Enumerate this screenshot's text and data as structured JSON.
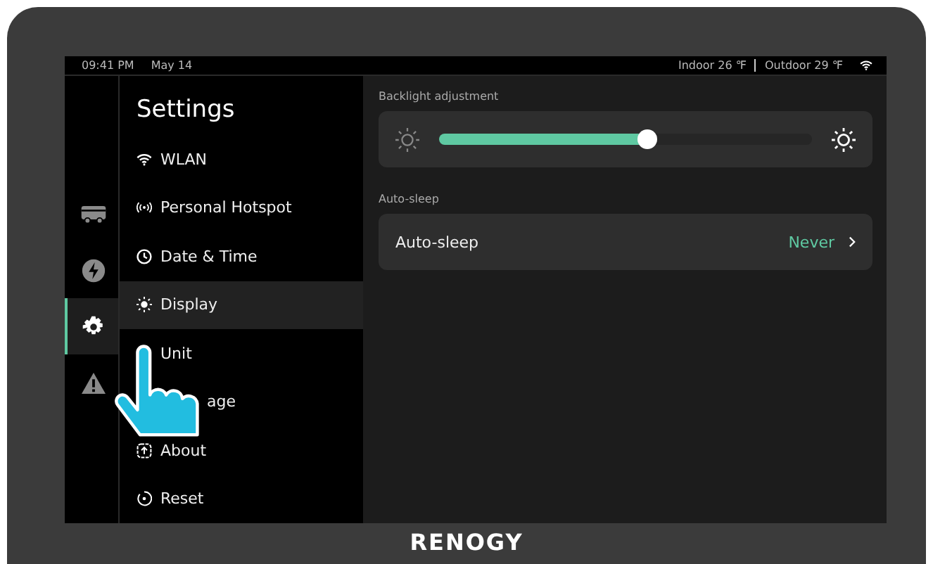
{
  "status_bar": {
    "time": "09:41 PM",
    "date": "May 14",
    "indoor": "Indoor 26 ℉",
    "outdoor": "Outdoor 29 ℉"
  },
  "rail": [
    {
      "kind": "rv",
      "selected": false
    },
    {
      "kind": "power",
      "selected": false
    },
    {
      "kind": "settings",
      "selected": true
    },
    {
      "kind": "alert",
      "selected": false
    }
  ],
  "menu": {
    "title": "Settings",
    "items": [
      {
        "kind": "wifi",
        "label": "WLAN",
        "selected": false
      },
      {
        "kind": "hotspot",
        "label": "Personal Hotspot",
        "selected": false
      },
      {
        "kind": "clock",
        "label": "Date & Time",
        "selected": false
      },
      {
        "kind": "sun",
        "label": "Display",
        "selected": true
      },
      {
        "kind": "none",
        "label": "Unit",
        "selected": false
      },
      {
        "kind": "covered",
        "label": "age",
        "selected": false
      },
      {
        "kind": "about",
        "label": "About",
        "selected": false
      },
      {
        "kind": "reset",
        "label": "Reset",
        "selected": false
      }
    ]
  },
  "backlight": {
    "label": "Backlight adjustment",
    "level": 0.56
  },
  "auto_sleep": {
    "section_label": "Auto-sleep",
    "label": "Auto-sleep",
    "value": "Never"
  },
  "brand": "RENOGY"
}
